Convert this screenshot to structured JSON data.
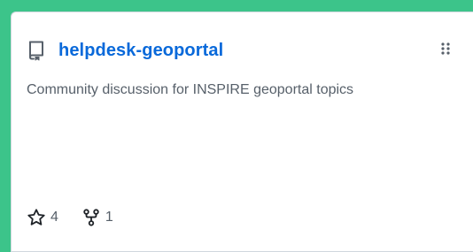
{
  "repo": {
    "name": "helpdesk-geoportal",
    "description": "Community discussion for INSPIRE geoportal topics",
    "stars": "4",
    "forks": "1",
    "icons": {
      "repo": "repo-icon",
      "star": "star-icon",
      "fork": "fork-icon",
      "drag": "drag-handle-icon"
    }
  },
  "colors": {
    "accent_frame": "#3cc48a",
    "link": "#0969da",
    "muted_text": "#57606a"
  }
}
